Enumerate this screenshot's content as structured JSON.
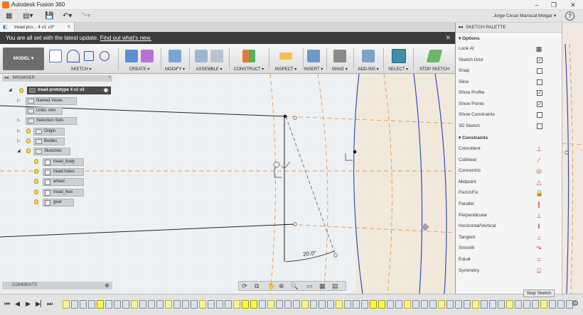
{
  "window": {
    "title": "Autodesk Fusion 360",
    "minimize": "–",
    "restore": "❐",
    "close": "✕"
  },
  "quick_access": {
    "user_name": "Jorge Cesar Mariscal Melgar ▾",
    "help": "?"
  },
  "document_tab": {
    "label": "tread pro... 4 v1 v3*",
    "close": "×"
  },
  "notification": {
    "message": "You are all set with the latest update.",
    "link": "Find out what's new.",
    "close": "✕"
  },
  "ribbon": {
    "workspace": "MODEL ▾",
    "groups": [
      "SKETCH ▾",
      "CREATE ▾",
      "MODIFY ▾",
      "ASSEMBLE ▾",
      "CONSTRUCT ▾",
      "INSPECT ▾",
      "INSERT ▾",
      "MAKE ▾",
      "ADD-INS ▾",
      "SELECT ▾",
      "STOP SKETCH"
    ]
  },
  "browser": {
    "header": "BROWSER",
    "root": "tread prototype 4 v1 v3",
    "items": [
      "Named Views",
      "Units: mm",
      "Selection Sets",
      "Origin",
      "Bodies",
      "Sketches"
    ],
    "sketches": [
      "tread_body",
      "tread holes",
      "wheel",
      "tread_feet",
      "gear"
    ]
  },
  "comments": {
    "label": "COMMENTS"
  },
  "canvas": {
    "dimension_label": "20.0°"
  },
  "palette": {
    "title": "SKETCH PALETTE",
    "options_header": "Options",
    "options": [
      {
        "label": "Look At",
        "checked": "icon"
      },
      {
        "label": "Sketch Grid",
        "checked": "✓"
      },
      {
        "label": "Snap",
        "checked": ""
      },
      {
        "label": "Slice",
        "checked": ""
      },
      {
        "label": "Show Profile",
        "checked": "✓"
      },
      {
        "label": "Show Points",
        "checked": "✓"
      },
      {
        "label": "Show Constraints",
        "checked": ""
      },
      {
        "label": "3D Sketch",
        "checked": ""
      }
    ],
    "constraints_header": "Constraints",
    "constraints": [
      {
        "label": "Coincident",
        "icon": "coincident-icon",
        "glyph": "⊥"
      },
      {
        "label": "Collinear",
        "icon": "collinear-icon",
        "glyph": "⁄"
      },
      {
        "label": "Concentric",
        "icon": "concentric-icon",
        "glyph": "◎"
      },
      {
        "label": "Midpoint",
        "icon": "midpoint-icon",
        "glyph": "△"
      },
      {
        "label": "Fix/UnFix",
        "icon": "lock-icon",
        "glyph": "🔒"
      },
      {
        "label": "Parallel",
        "icon": "parallel-icon",
        "glyph": "∥"
      },
      {
        "label": "Perpendicular",
        "icon": "perpendicular-icon",
        "glyph": "⟂"
      },
      {
        "label": "Horizontal/Vertical",
        "icon": "horizontal-vertical-icon",
        "glyph": "‖"
      },
      {
        "label": "Tangent",
        "icon": "tangent-icon",
        "glyph": "⌂"
      },
      {
        "label": "Smooth",
        "icon": "smooth-icon",
        "glyph": "↷"
      },
      {
        "label": "Equal",
        "icon": "equal-icon",
        "glyph": "="
      },
      {
        "label": "Symmetry",
        "icon": "symmetry-icon",
        "glyph": "⌸"
      }
    ],
    "stop_button": "Stop Sketch"
  },
  "colors": {
    "accent": "#f07a1f",
    "sketch_blue": "#2f4fb8",
    "construction": "#e8964a"
  }
}
